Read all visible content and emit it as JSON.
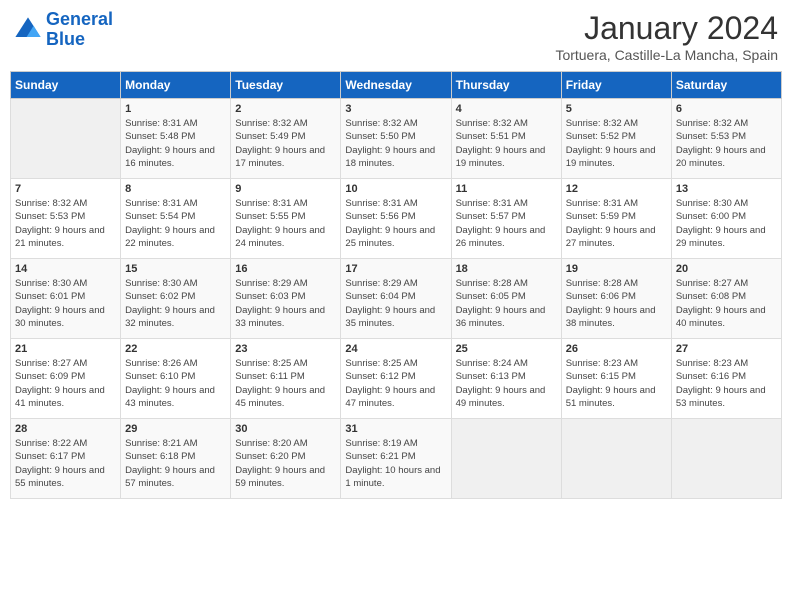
{
  "logo": {
    "line1": "General",
    "line2": "Blue"
  },
  "title": "January 2024",
  "location": "Tortuera, Castille-La Mancha, Spain",
  "days_of_week": [
    "Sunday",
    "Monday",
    "Tuesday",
    "Wednesday",
    "Thursday",
    "Friday",
    "Saturday"
  ],
  "weeks": [
    [
      {
        "num": "",
        "sunrise": "",
        "sunset": "",
        "daylight": ""
      },
      {
        "num": "1",
        "sunrise": "Sunrise: 8:31 AM",
        "sunset": "Sunset: 5:48 PM",
        "daylight": "Daylight: 9 hours and 16 minutes."
      },
      {
        "num": "2",
        "sunrise": "Sunrise: 8:32 AM",
        "sunset": "Sunset: 5:49 PM",
        "daylight": "Daylight: 9 hours and 17 minutes."
      },
      {
        "num": "3",
        "sunrise": "Sunrise: 8:32 AM",
        "sunset": "Sunset: 5:50 PM",
        "daylight": "Daylight: 9 hours and 18 minutes."
      },
      {
        "num": "4",
        "sunrise": "Sunrise: 8:32 AM",
        "sunset": "Sunset: 5:51 PM",
        "daylight": "Daylight: 9 hours and 19 minutes."
      },
      {
        "num": "5",
        "sunrise": "Sunrise: 8:32 AM",
        "sunset": "Sunset: 5:52 PM",
        "daylight": "Daylight: 9 hours and 19 minutes."
      },
      {
        "num": "6",
        "sunrise": "Sunrise: 8:32 AM",
        "sunset": "Sunset: 5:53 PM",
        "daylight": "Daylight: 9 hours and 20 minutes."
      }
    ],
    [
      {
        "num": "7",
        "sunrise": "Sunrise: 8:32 AM",
        "sunset": "Sunset: 5:53 PM",
        "daylight": "Daylight: 9 hours and 21 minutes."
      },
      {
        "num": "8",
        "sunrise": "Sunrise: 8:31 AM",
        "sunset": "Sunset: 5:54 PM",
        "daylight": "Daylight: 9 hours and 22 minutes."
      },
      {
        "num": "9",
        "sunrise": "Sunrise: 8:31 AM",
        "sunset": "Sunset: 5:55 PM",
        "daylight": "Daylight: 9 hours and 24 minutes."
      },
      {
        "num": "10",
        "sunrise": "Sunrise: 8:31 AM",
        "sunset": "Sunset: 5:56 PM",
        "daylight": "Daylight: 9 hours and 25 minutes."
      },
      {
        "num": "11",
        "sunrise": "Sunrise: 8:31 AM",
        "sunset": "Sunset: 5:57 PM",
        "daylight": "Daylight: 9 hours and 26 minutes."
      },
      {
        "num": "12",
        "sunrise": "Sunrise: 8:31 AM",
        "sunset": "Sunset: 5:59 PM",
        "daylight": "Daylight: 9 hours and 27 minutes."
      },
      {
        "num": "13",
        "sunrise": "Sunrise: 8:30 AM",
        "sunset": "Sunset: 6:00 PM",
        "daylight": "Daylight: 9 hours and 29 minutes."
      }
    ],
    [
      {
        "num": "14",
        "sunrise": "Sunrise: 8:30 AM",
        "sunset": "Sunset: 6:01 PM",
        "daylight": "Daylight: 9 hours and 30 minutes."
      },
      {
        "num": "15",
        "sunrise": "Sunrise: 8:30 AM",
        "sunset": "Sunset: 6:02 PM",
        "daylight": "Daylight: 9 hours and 32 minutes."
      },
      {
        "num": "16",
        "sunrise": "Sunrise: 8:29 AM",
        "sunset": "Sunset: 6:03 PM",
        "daylight": "Daylight: 9 hours and 33 minutes."
      },
      {
        "num": "17",
        "sunrise": "Sunrise: 8:29 AM",
        "sunset": "Sunset: 6:04 PM",
        "daylight": "Daylight: 9 hours and 35 minutes."
      },
      {
        "num": "18",
        "sunrise": "Sunrise: 8:28 AM",
        "sunset": "Sunset: 6:05 PM",
        "daylight": "Daylight: 9 hours and 36 minutes."
      },
      {
        "num": "19",
        "sunrise": "Sunrise: 8:28 AM",
        "sunset": "Sunset: 6:06 PM",
        "daylight": "Daylight: 9 hours and 38 minutes."
      },
      {
        "num": "20",
        "sunrise": "Sunrise: 8:27 AM",
        "sunset": "Sunset: 6:08 PM",
        "daylight": "Daylight: 9 hours and 40 minutes."
      }
    ],
    [
      {
        "num": "21",
        "sunrise": "Sunrise: 8:27 AM",
        "sunset": "Sunset: 6:09 PM",
        "daylight": "Daylight: 9 hours and 41 minutes."
      },
      {
        "num": "22",
        "sunrise": "Sunrise: 8:26 AM",
        "sunset": "Sunset: 6:10 PM",
        "daylight": "Daylight: 9 hours and 43 minutes."
      },
      {
        "num": "23",
        "sunrise": "Sunrise: 8:25 AM",
        "sunset": "Sunset: 6:11 PM",
        "daylight": "Daylight: 9 hours and 45 minutes."
      },
      {
        "num": "24",
        "sunrise": "Sunrise: 8:25 AM",
        "sunset": "Sunset: 6:12 PM",
        "daylight": "Daylight: 9 hours and 47 minutes."
      },
      {
        "num": "25",
        "sunrise": "Sunrise: 8:24 AM",
        "sunset": "Sunset: 6:13 PM",
        "daylight": "Daylight: 9 hours and 49 minutes."
      },
      {
        "num": "26",
        "sunrise": "Sunrise: 8:23 AM",
        "sunset": "Sunset: 6:15 PM",
        "daylight": "Daylight: 9 hours and 51 minutes."
      },
      {
        "num": "27",
        "sunrise": "Sunrise: 8:23 AM",
        "sunset": "Sunset: 6:16 PM",
        "daylight": "Daylight: 9 hours and 53 minutes."
      }
    ],
    [
      {
        "num": "28",
        "sunrise": "Sunrise: 8:22 AM",
        "sunset": "Sunset: 6:17 PM",
        "daylight": "Daylight: 9 hours and 55 minutes."
      },
      {
        "num": "29",
        "sunrise": "Sunrise: 8:21 AM",
        "sunset": "Sunset: 6:18 PM",
        "daylight": "Daylight: 9 hours and 57 minutes."
      },
      {
        "num": "30",
        "sunrise": "Sunrise: 8:20 AM",
        "sunset": "Sunset: 6:20 PM",
        "daylight": "Daylight: 9 hours and 59 minutes."
      },
      {
        "num": "31",
        "sunrise": "Sunrise: 8:19 AM",
        "sunset": "Sunset: 6:21 PM",
        "daylight": "Daylight: 10 hours and 1 minute."
      },
      {
        "num": "",
        "sunrise": "",
        "sunset": "",
        "daylight": ""
      },
      {
        "num": "",
        "sunrise": "",
        "sunset": "",
        "daylight": ""
      },
      {
        "num": "",
        "sunrise": "",
        "sunset": "",
        "daylight": ""
      }
    ]
  ]
}
